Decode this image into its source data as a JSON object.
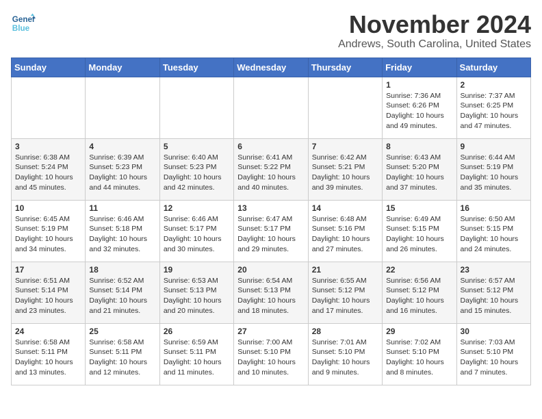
{
  "header": {
    "logo_line1": "General",
    "logo_line2": "Blue",
    "month_title": "November 2024",
    "subtitle": "Andrews, South Carolina, United States"
  },
  "weekdays": [
    "Sunday",
    "Monday",
    "Tuesday",
    "Wednesday",
    "Thursday",
    "Friday",
    "Saturday"
  ],
  "weeks": [
    [
      {
        "day": "",
        "info": ""
      },
      {
        "day": "",
        "info": ""
      },
      {
        "day": "",
        "info": ""
      },
      {
        "day": "",
        "info": ""
      },
      {
        "day": "",
        "info": ""
      },
      {
        "day": "1",
        "info": "Sunrise: 7:36 AM\nSunset: 6:26 PM\nDaylight: 10 hours and 49 minutes."
      },
      {
        "day": "2",
        "info": "Sunrise: 7:37 AM\nSunset: 6:25 PM\nDaylight: 10 hours and 47 minutes."
      }
    ],
    [
      {
        "day": "3",
        "info": "Sunrise: 6:38 AM\nSunset: 5:24 PM\nDaylight: 10 hours and 45 minutes."
      },
      {
        "day": "4",
        "info": "Sunrise: 6:39 AM\nSunset: 5:23 PM\nDaylight: 10 hours and 44 minutes."
      },
      {
        "day": "5",
        "info": "Sunrise: 6:40 AM\nSunset: 5:23 PM\nDaylight: 10 hours and 42 minutes."
      },
      {
        "day": "6",
        "info": "Sunrise: 6:41 AM\nSunset: 5:22 PM\nDaylight: 10 hours and 40 minutes."
      },
      {
        "day": "7",
        "info": "Sunrise: 6:42 AM\nSunset: 5:21 PM\nDaylight: 10 hours and 39 minutes."
      },
      {
        "day": "8",
        "info": "Sunrise: 6:43 AM\nSunset: 5:20 PM\nDaylight: 10 hours and 37 minutes."
      },
      {
        "day": "9",
        "info": "Sunrise: 6:44 AM\nSunset: 5:19 PM\nDaylight: 10 hours and 35 minutes."
      }
    ],
    [
      {
        "day": "10",
        "info": "Sunrise: 6:45 AM\nSunset: 5:19 PM\nDaylight: 10 hours and 34 minutes."
      },
      {
        "day": "11",
        "info": "Sunrise: 6:46 AM\nSunset: 5:18 PM\nDaylight: 10 hours and 32 minutes."
      },
      {
        "day": "12",
        "info": "Sunrise: 6:46 AM\nSunset: 5:17 PM\nDaylight: 10 hours and 30 minutes."
      },
      {
        "day": "13",
        "info": "Sunrise: 6:47 AM\nSunset: 5:17 PM\nDaylight: 10 hours and 29 minutes."
      },
      {
        "day": "14",
        "info": "Sunrise: 6:48 AM\nSunset: 5:16 PM\nDaylight: 10 hours and 27 minutes."
      },
      {
        "day": "15",
        "info": "Sunrise: 6:49 AM\nSunset: 5:15 PM\nDaylight: 10 hours and 26 minutes."
      },
      {
        "day": "16",
        "info": "Sunrise: 6:50 AM\nSunset: 5:15 PM\nDaylight: 10 hours and 24 minutes."
      }
    ],
    [
      {
        "day": "17",
        "info": "Sunrise: 6:51 AM\nSunset: 5:14 PM\nDaylight: 10 hours and 23 minutes."
      },
      {
        "day": "18",
        "info": "Sunrise: 6:52 AM\nSunset: 5:14 PM\nDaylight: 10 hours and 21 minutes."
      },
      {
        "day": "19",
        "info": "Sunrise: 6:53 AM\nSunset: 5:13 PM\nDaylight: 10 hours and 20 minutes."
      },
      {
        "day": "20",
        "info": "Sunrise: 6:54 AM\nSunset: 5:13 PM\nDaylight: 10 hours and 18 minutes."
      },
      {
        "day": "21",
        "info": "Sunrise: 6:55 AM\nSunset: 5:12 PM\nDaylight: 10 hours and 17 minutes."
      },
      {
        "day": "22",
        "info": "Sunrise: 6:56 AM\nSunset: 5:12 PM\nDaylight: 10 hours and 16 minutes."
      },
      {
        "day": "23",
        "info": "Sunrise: 6:57 AM\nSunset: 5:12 PM\nDaylight: 10 hours and 15 minutes."
      }
    ],
    [
      {
        "day": "24",
        "info": "Sunrise: 6:58 AM\nSunset: 5:11 PM\nDaylight: 10 hours and 13 minutes."
      },
      {
        "day": "25",
        "info": "Sunrise: 6:58 AM\nSunset: 5:11 PM\nDaylight: 10 hours and 12 minutes."
      },
      {
        "day": "26",
        "info": "Sunrise: 6:59 AM\nSunset: 5:11 PM\nDaylight: 10 hours and 11 minutes."
      },
      {
        "day": "27",
        "info": "Sunrise: 7:00 AM\nSunset: 5:10 PM\nDaylight: 10 hours and 10 minutes."
      },
      {
        "day": "28",
        "info": "Sunrise: 7:01 AM\nSunset: 5:10 PM\nDaylight: 10 hours and 9 minutes."
      },
      {
        "day": "29",
        "info": "Sunrise: 7:02 AM\nSunset: 5:10 PM\nDaylight: 10 hours and 8 minutes."
      },
      {
        "day": "30",
        "info": "Sunrise: 7:03 AM\nSunset: 5:10 PM\nDaylight: 10 hours and 7 minutes."
      }
    ]
  ]
}
